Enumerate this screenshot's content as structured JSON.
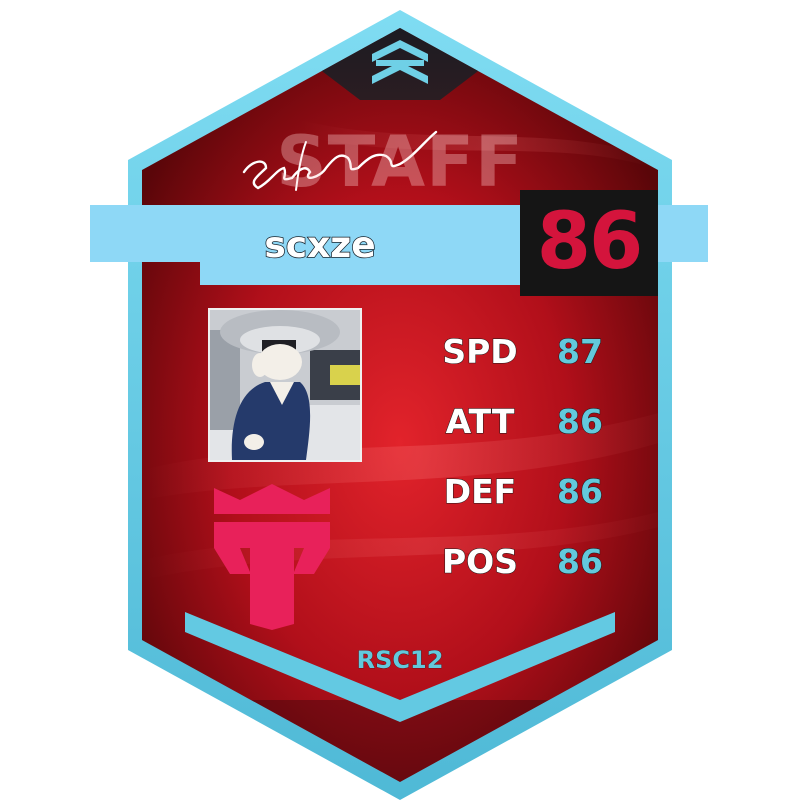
{
  "card": {
    "watermark": "STAFF",
    "name": "scxze",
    "signature": "scxze",
    "rating": "86",
    "season": "RSC12",
    "stats": [
      {
        "label": "SPD",
        "value": "87"
      },
      {
        "label": "ATT",
        "value": "86"
      },
      {
        "label": "DEF",
        "value": "86"
      },
      {
        "label": "POS",
        "value": "86"
      }
    ],
    "logo_icon": "crown-t-icon",
    "top_emblem_icon": "layered-chevrons-icon",
    "avatar": "cat-in-suit-photo"
  },
  "colors": {
    "frame": "#5cc8e4",
    "background_red": "#b3101d",
    "banner": "#8ed8f6",
    "rating_box": "#151515",
    "rating_text": "#d4143c",
    "logo": "#e8215a",
    "stat_value": "#63c9dc"
  }
}
